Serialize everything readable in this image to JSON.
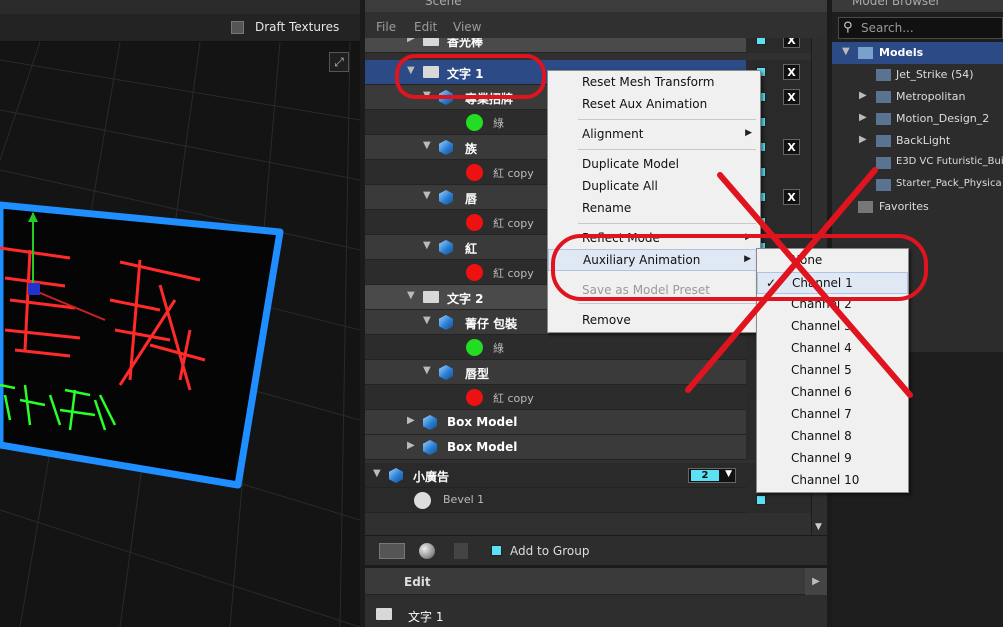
{
  "viewport": {
    "draft_textures_label": "Draft Textures",
    "expand_icon": "expand-icon"
  },
  "scene": {
    "title": "Scene",
    "menu": [
      "File",
      "Edit",
      "View"
    ],
    "rows": [
      {
        "type": "group",
        "label": "香光棒",
        "indent": 0
      },
      {
        "type": "group",
        "label": "文字 1",
        "indent": 0,
        "selected": true
      },
      {
        "type": "model",
        "label": "專業招牌",
        "indent": 1
      },
      {
        "type": "mat",
        "label": "綠",
        "color": "#22dd22"
      },
      {
        "type": "model",
        "label": "族",
        "indent": 1
      },
      {
        "type": "mat",
        "label": "紅 copy",
        "color": "#ee1111"
      },
      {
        "type": "model",
        "label": "唇",
        "indent": 1
      },
      {
        "type": "mat",
        "label": "紅 copy",
        "color": "#ee1111"
      },
      {
        "type": "model",
        "label": "紅",
        "indent": 1
      },
      {
        "type": "mat",
        "label": "紅 copy",
        "color": "#ee1111"
      },
      {
        "type": "group",
        "label": "文字 2",
        "indent": 0
      },
      {
        "type": "model",
        "label": "菁仔 包裝",
        "indent": 1
      },
      {
        "type": "mat",
        "label": "綠",
        "color": "#22dd22"
      },
      {
        "type": "model",
        "label": "唇型",
        "indent": 1
      },
      {
        "type": "mat",
        "label": "紅 copy",
        "color": "#ee1111"
      },
      {
        "type": "model",
        "label": "Box Model",
        "indent": 0
      },
      {
        "type": "model",
        "label": "Box Model",
        "indent": 0
      },
      {
        "type": "model",
        "label": "小廣告",
        "indent": -1
      },
      {
        "type": "mat",
        "label": "Bevel 1",
        "color": "#dddddd"
      }
    ],
    "anim_channel_value": "2",
    "add_to_group_label": "Add to Group"
  },
  "edit": {
    "title": "Edit",
    "item_name": "文字 1"
  },
  "browser": {
    "title": "Model Browser",
    "search_placeholder": "Search...",
    "items": [
      {
        "label": "Models",
        "level": 0,
        "expanded": true,
        "selected": true
      },
      {
        "label": "Jet_Strike (54)",
        "level": 1
      },
      {
        "label": "Metropolitan",
        "level": 1,
        "collapsed": true
      },
      {
        "label": "Motion_Design_2",
        "level": 1,
        "collapsed": true
      },
      {
        "label": "BackLight",
        "level": 1,
        "collapsed": true
      },
      {
        "label": "E3D VC Futuristic_Bui",
        "level": 1
      },
      {
        "label": "Starter_Pack_Physica",
        "level": 1
      },
      {
        "label": "Favorites",
        "level": 0
      }
    ]
  },
  "context_menu": {
    "items": [
      {
        "label": "Reset Mesh Transform"
      },
      {
        "label": "Reset Aux Animation"
      },
      {
        "sep": true
      },
      {
        "label": "Alignment",
        "submenu": true
      },
      {
        "sep": true
      },
      {
        "label": "Duplicate Model"
      },
      {
        "label": "Duplicate All"
      },
      {
        "label": "Rename"
      },
      {
        "sep": true
      },
      {
        "label": "Reflect Mode",
        "submenu": true
      },
      {
        "label": "Auxiliary Animation",
        "submenu": true,
        "highlighted": true
      },
      {
        "label": "Save as Model Preset",
        "disabled": true
      },
      {
        "sep": true
      },
      {
        "label": "Remove"
      }
    ]
  },
  "submenu": {
    "items": [
      "None",
      "Channel 1",
      "Channel 2",
      "Channel 3",
      "Channel 4",
      "Channel 5",
      "Channel 6",
      "Channel 7",
      "Channel 8",
      "Channel 9",
      "Channel 10"
    ],
    "checked": "Channel 1"
  },
  "colors": {
    "selection": "#2b4a86",
    "annotation": "#e0141e",
    "neon_red": "#ff2a2a",
    "neon_green": "#2aff2a",
    "sign_border": "#1f8fff"
  }
}
